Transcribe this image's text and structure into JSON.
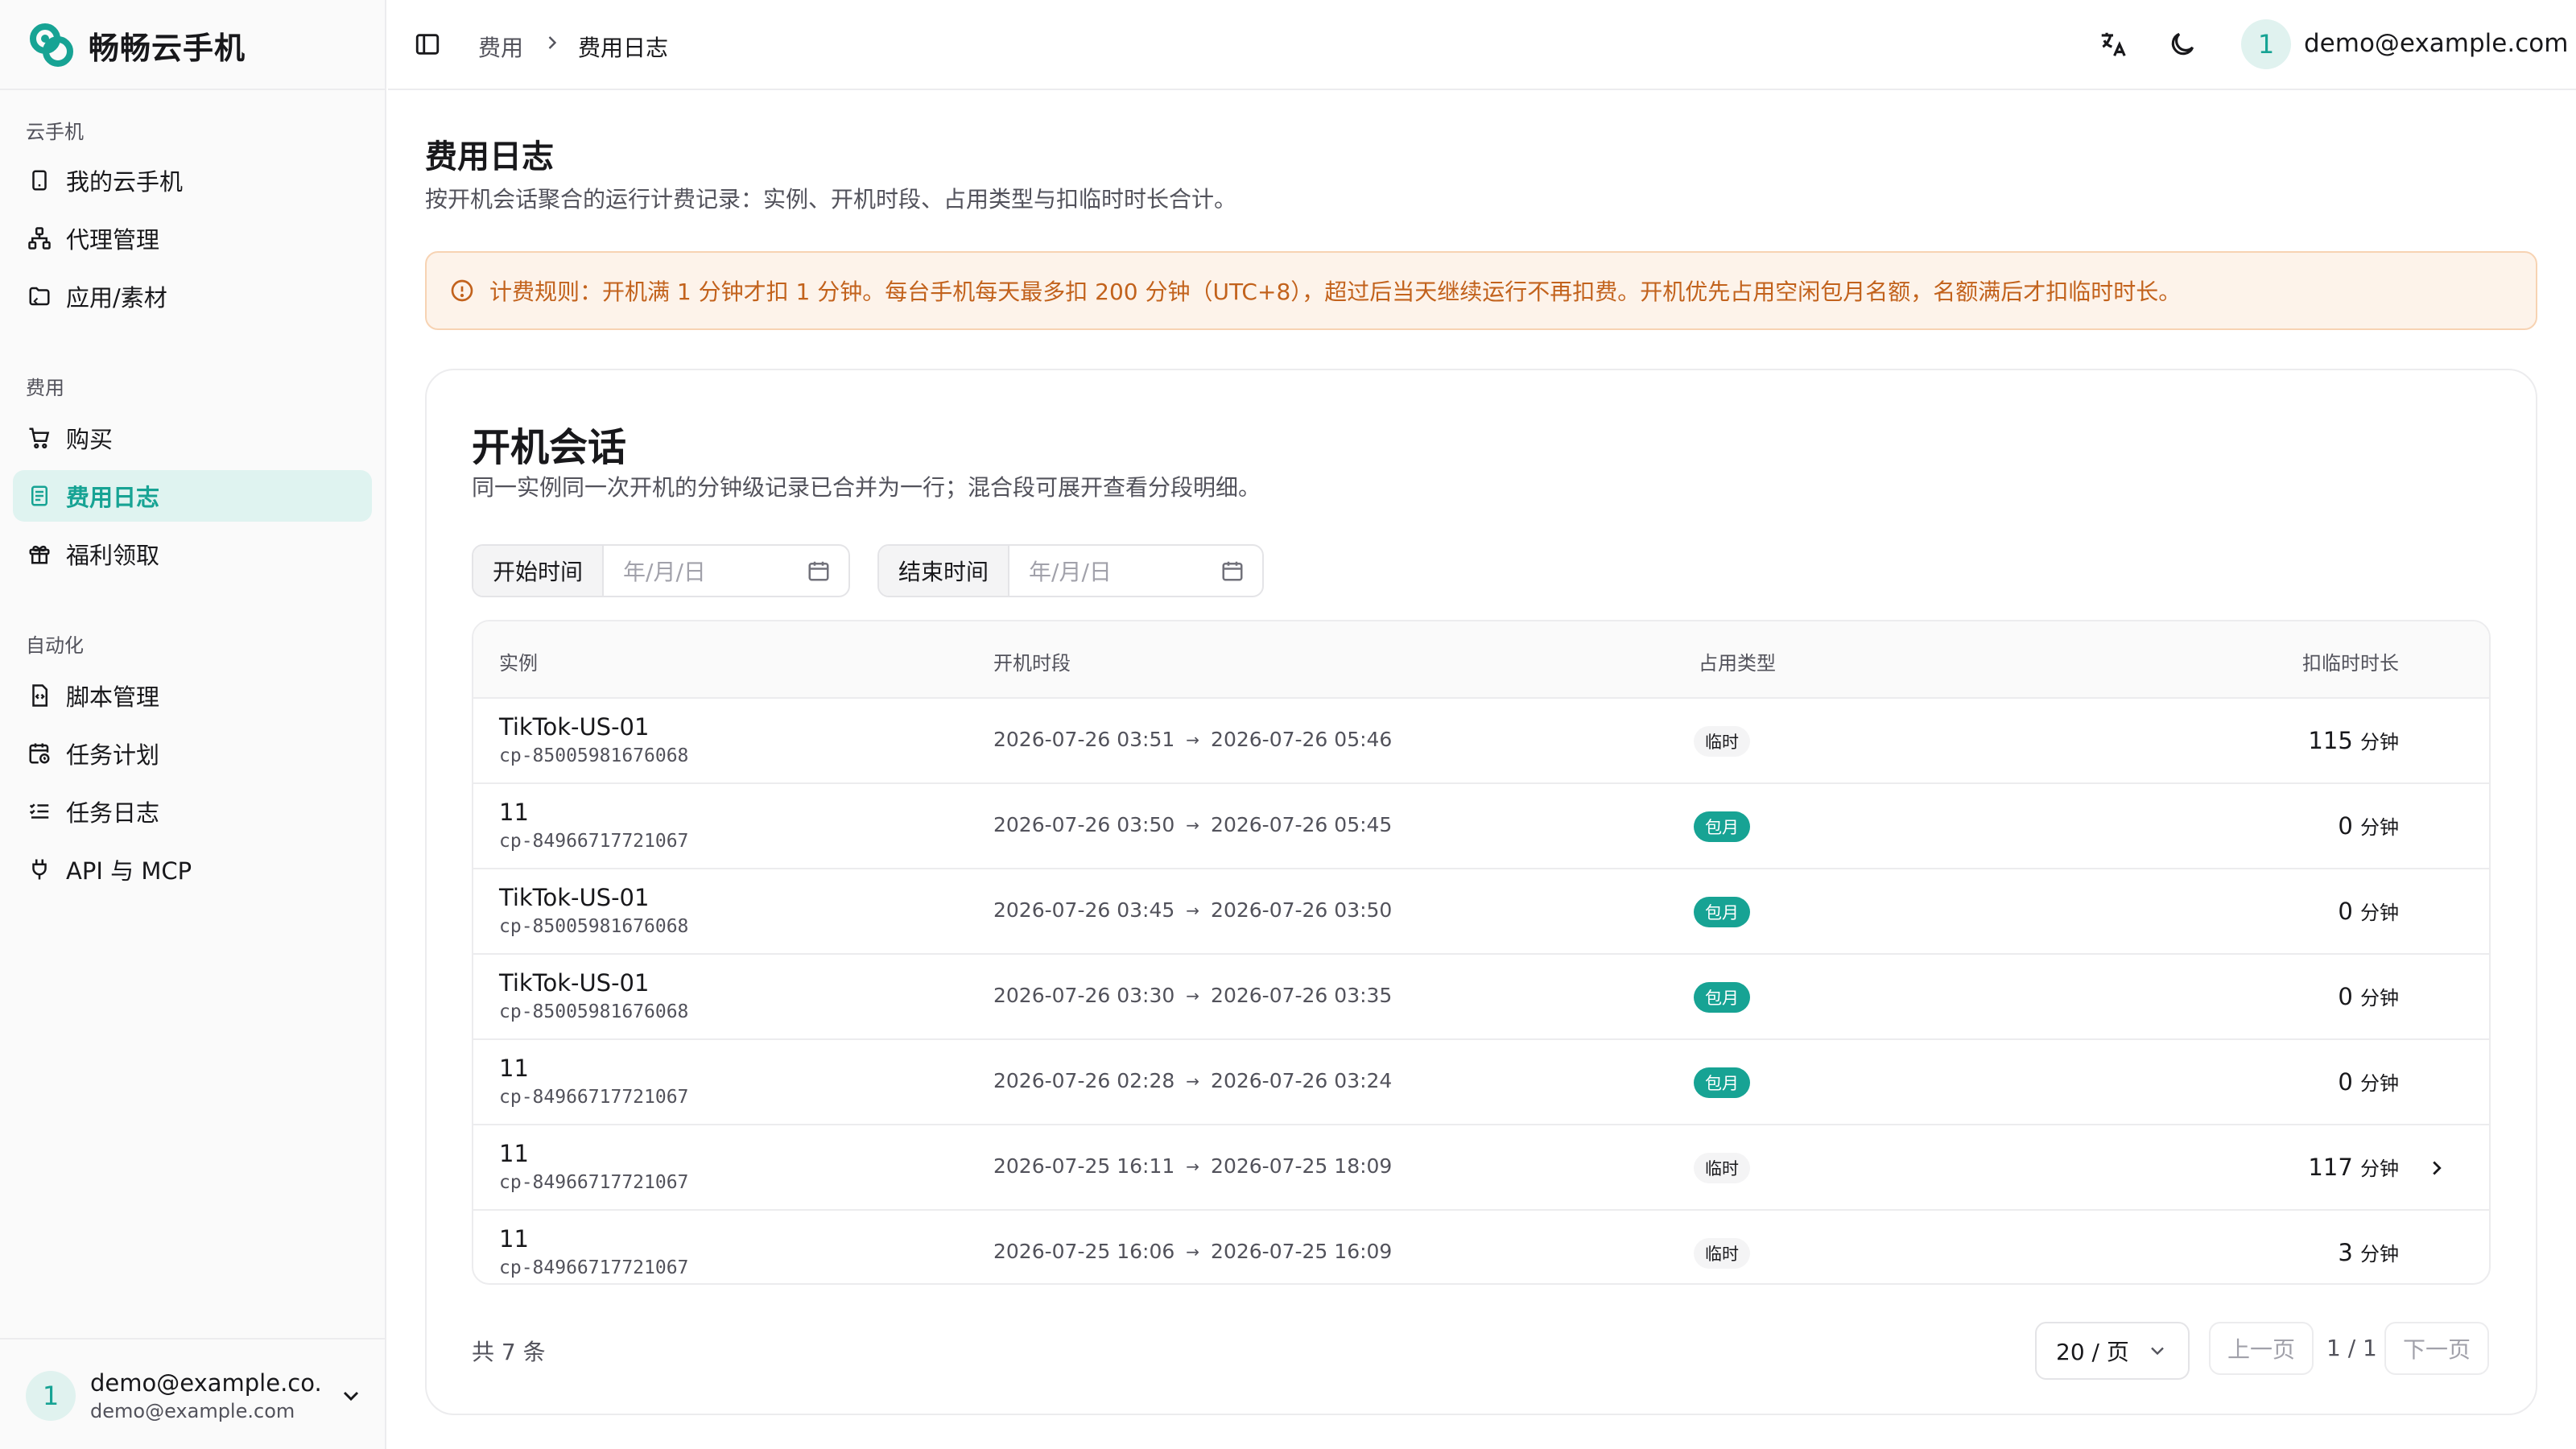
{
  "app": {
    "name": "畅畅云手机",
    "brand_color": "#17a394"
  },
  "sidebar": {
    "groups": [
      {
        "label": "云手机",
        "items": [
          {
            "label": "我的云手机",
            "icon": "phone-icon"
          },
          {
            "label": "代理管理",
            "icon": "network-icon"
          },
          {
            "label": "应用/素材",
            "icon": "folder-icon"
          }
        ]
      },
      {
        "label": "费用",
        "items": [
          {
            "label": "购买",
            "icon": "cart-icon"
          },
          {
            "label": "费用日志",
            "icon": "receipt-icon",
            "active": true
          },
          {
            "label": "福利领取",
            "icon": "gift-icon"
          }
        ]
      },
      {
        "label": "自动化",
        "items": [
          {
            "label": "脚本管理",
            "icon": "script-icon"
          },
          {
            "label": "任务计划",
            "icon": "calendar-clock-icon"
          },
          {
            "label": "任务日志",
            "icon": "list-check-icon"
          },
          {
            "label": "API 与 MCP",
            "icon": "plug-icon"
          }
        ]
      }
    ],
    "user": {
      "avatar": "1",
      "name": "demo@example.co...",
      "email": "demo@example.com"
    }
  },
  "header": {
    "breadcrumb": [
      "费用",
      "费用日志"
    ],
    "avatar": "1",
    "email": "demo@example.com"
  },
  "page": {
    "title": "费用日志",
    "description": "按开机会话聚合的运行计费记录：实例、开机时段、占用类型与扣临时时长合计。",
    "alert": "计费规则：开机满 1 分钟才扣 1 分钟。每台手机每天最多扣 200 分钟（UTC+8），超过后当天继续运行不再扣费。开机优先占用空闲包月名额，名额满后才扣临时时长。"
  },
  "card": {
    "title": "开机会话",
    "description": "同一实例同一次开机的分钟级记录已合并为一行；混合段可展开查看分段明细。",
    "filters": {
      "start_label": "开始时间",
      "start_placeholder": "年/月/日",
      "end_label": "结束时间",
      "end_placeholder": "年/月/日"
    },
    "columns": [
      "实例",
      "开机时段",
      "占用类型",
      "扣临时时长"
    ],
    "rows": [
      {
        "name": "TikTok-US-01",
        "id": "cp-85005981676068",
        "start": "2026-07-26 03:51",
        "end": "2026-07-26 05:46",
        "type": "临时",
        "duration": "115",
        "unit": "分钟"
      },
      {
        "name": "11",
        "id": "cp-84966717721067",
        "start": "2026-07-26 03:50",
        "end": "2026-07-26 05:45",
        "type": "包月",
        "duration": "0",
        "unit": "分钟"
      },
      {
        "name": "TikTok-US-01",
        "id": "cp-85005981676068",
        "start": "2026-07-26 03:45",
        "end": "2026-07-26 03:50",
        "type": "包月",
        "duration": "0",
        "unit": "分钟"
      },
      {
        "name": "TikTok-US-01",
        "id": "cp-85005981676068",
        "start": "2026-07-26 03:30",
        "end": "2026-07-26 03:35",
        "type": "包月",
        "duration": "0",
        "unit": "分钟"
      },
      {
        "name": "11",
        "id": "cp-84966717721067",
        "start": "2026-07-26 02:28",
        "end": "2026-07-26 03:24",
        "type": "包月",
        "duration": "0",
        "unit": "分钟"
      },
      {
        "name": "11",
        "id": "cp-84966717721067",
        "start": "2026-07-25 16:11",
        "end": "2026-07-25 18:09",
        "type": "临时",
        "duration": "117",
        "unit": "分钟",
        "expandable": true
      },
      {
        "name": "11",
        "id": "cp-84966717721067",
        "start": "2026-07-25 16:06",
        "end": "2026-07-25 16:09",
        "type": "临时",
        "duration": "3",
        "unit": "分钟"
      }
    ],
    "pagination": {
      "total": "共 7 条",
      "page_size": "20 / 页",
      "prev": "上一页",
      "position": "1 / 1",
      "next": "下一页"
    }
  }
}
